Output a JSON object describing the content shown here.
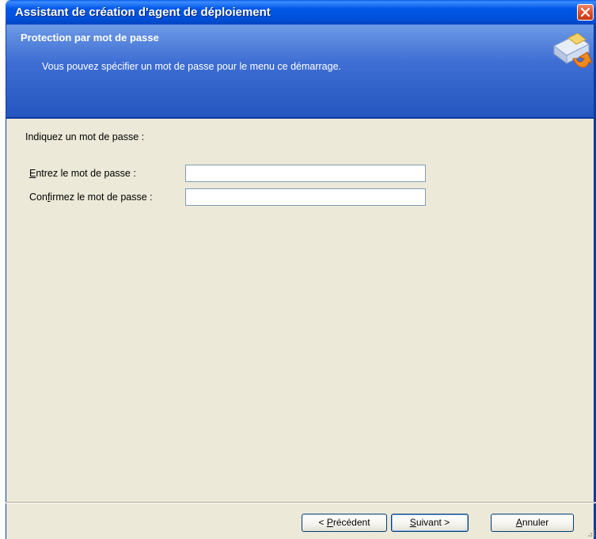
{
  "window": {
    "title": "Assistant de création d'agent de déploiement"
  },
  "header": {
    "title": "Protection par mot de passe",
    "subtitle": "Vous pouvez spécifier un mot de passe pour le menu ce démarrage."
  },
  "form": {
    "prompt": "Indiquez un mot de passe :",
    "password_label_key": "E",
    "password_label_rest": "ntrez le mot de passe :",
    "password_value": "",
    "confirm_label_pre": "Con",
    "confirm_label_key": "f",
    "confirm_label_rest": "irmez le mot de passe :",
    "confirm_value": ""
  },
  "buttons": {
    "back_pre": "< ",
    "back_key": "P",
    "back_rest": "récédent",
    "next_key": "S",
    "next_rest": "uivant >",
    "cancel_key": "A",
    "cancel_rest": "nnuler"
  },
  "icons": {
    "close": "close-icon",
    "wizard": "disk-arrow-icon",
    "grip": "resize-grip-icon"
  },
  "colors": {
    "titlebar": "#0058e6",
    "header": "#3f6fd3",
    "face": "#ece9d8",
    "close": "#e04f28"
  }
}
